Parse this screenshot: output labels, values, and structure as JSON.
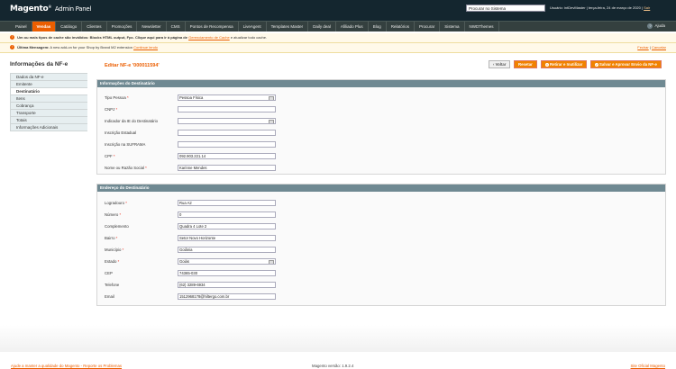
{
  "header": {
    "logo": "Magento",
    "logo_sub": "Admin Panel",
    "search_value": "Procurar no Sistema",
    "user_text": "Usuário: intDevMaster  |  terça-feira, 24 de março de 2020  |",
    "logout": "Sair"
  },
  "nav": {
    "items": [
      "Painel",
      "Vendas",
      "Catálogo",
      "Clientes",
      "Promoções",
      "Newsletter",
      "CMS",
      "Pontos de Recompensa",
      "LiveAgent",
      "Templates Master",
      "Daily deal",
      "Afiliado Plus",
      "Blog",
      "Relatórios",
      "Procurar",
      "Sistema",
      "NWDThemes"
    ],
    "help": "Ajuda"
  },
  "notices": {
    "cache_text": "Um ou mais tipos de cache são inválidos: Blocks HTML output, Fpc. Clique aqui para ir à página de",
    "cache_link": "Gerenciamento de Cache",
    "cache_suffix": "e atualizar todo cache.",
    "message_prefix": "Última Mensagem:",
    "message_text": "A new add-on for your Shop by Brand M2 extension",
    "message_link": "Continue lendo",
    "close": "Fechar",
    "separator": " | ",
    "dismiss": "Cancelar"
  },
  "sidebar": {
    "title": "Informações da NF-e",
    "tabs": [
      "Dados da NF-e",
      "Emitente",
      "Destinatário",
      "Itens",
      "Cobrança",
      "Transporte",
      "Totais",
      "Informações Adicionais"
    ]
  },
  "page": {
    "title": "Editar NF-e '000011594'",
    "buttons": {
      "back": "Voltar",
      "reset": "Resetar",
      "delete": "Retirar e Inutilizar",
      "save": "Salvar e Aprovar Envio da NF-e"
    }
  },
  "section1": {
    "title": "Informações do Destinatário",
    "fields": [
      {
        "label": "Tipo Pessoa",
        "required": true,
        "value": "Pessoa Física"
      },
      {
        "label": "CNPJ",
        "required": true,
        "value": ""
      },
      {
        "label": "Indicador da IE do Destinatário",
        "required": false,
        "value": ""
      },
      {
        "label": "Inscrição Estadual",
        "required": false,
        "value": ""
      },
      {
        "label": "Inscrição na SUFRAMA",
        "required": false,
        "value": ""
      },
      {
        "label": "CPF",
        "required": true,
        "value": "092.903.221.14"
      },
      {
        "label": "Nome ou Razão Social",
        "required": true,
        "value": "Karinne Mendes"
      }
    ]
  },
  "section2": {
    "title": "Endereço do Destinatário",
    "fields": [
      {
        "label": "Logradouro",
        "required": true,
        "value": "Rua A2"
      },
      {
        "label": "Número",
        "required": true,
        "value": "0"
      },
      {
        "label": "Complemento",
        "required": false,
        "value": "Quadra 4 Lote 2"
      },
      {
        "label": "Bairro",
        "required": true,
        "value": "Setor Novo Horizonte"
      },
      {
        "label": "Município",
        "required": true,
        "value": "Goiânia"
      },
      {
        "label": "Estado",
        "required": true,
        "value": "Goiás"
      },
      {
        "label": "CEP",
        "required": false,
        "value": "74365-030"
      },
      {
        "label": "Telefone",
        "required": false,
        "value": "(62) 3289-6934"
      },
      {
        "label": "Email",
        "required": false,
        "value": "1512968178@hiltergo.com.br"
      }
    ]
  },
  "footer": {
    "left": "Ajude a manter a qualidade do Magento - Reporte os Problemas",
    "center": "Magento versão: 1.9.2.4",
    "right": "Site Oficial Magento"
  }
}
